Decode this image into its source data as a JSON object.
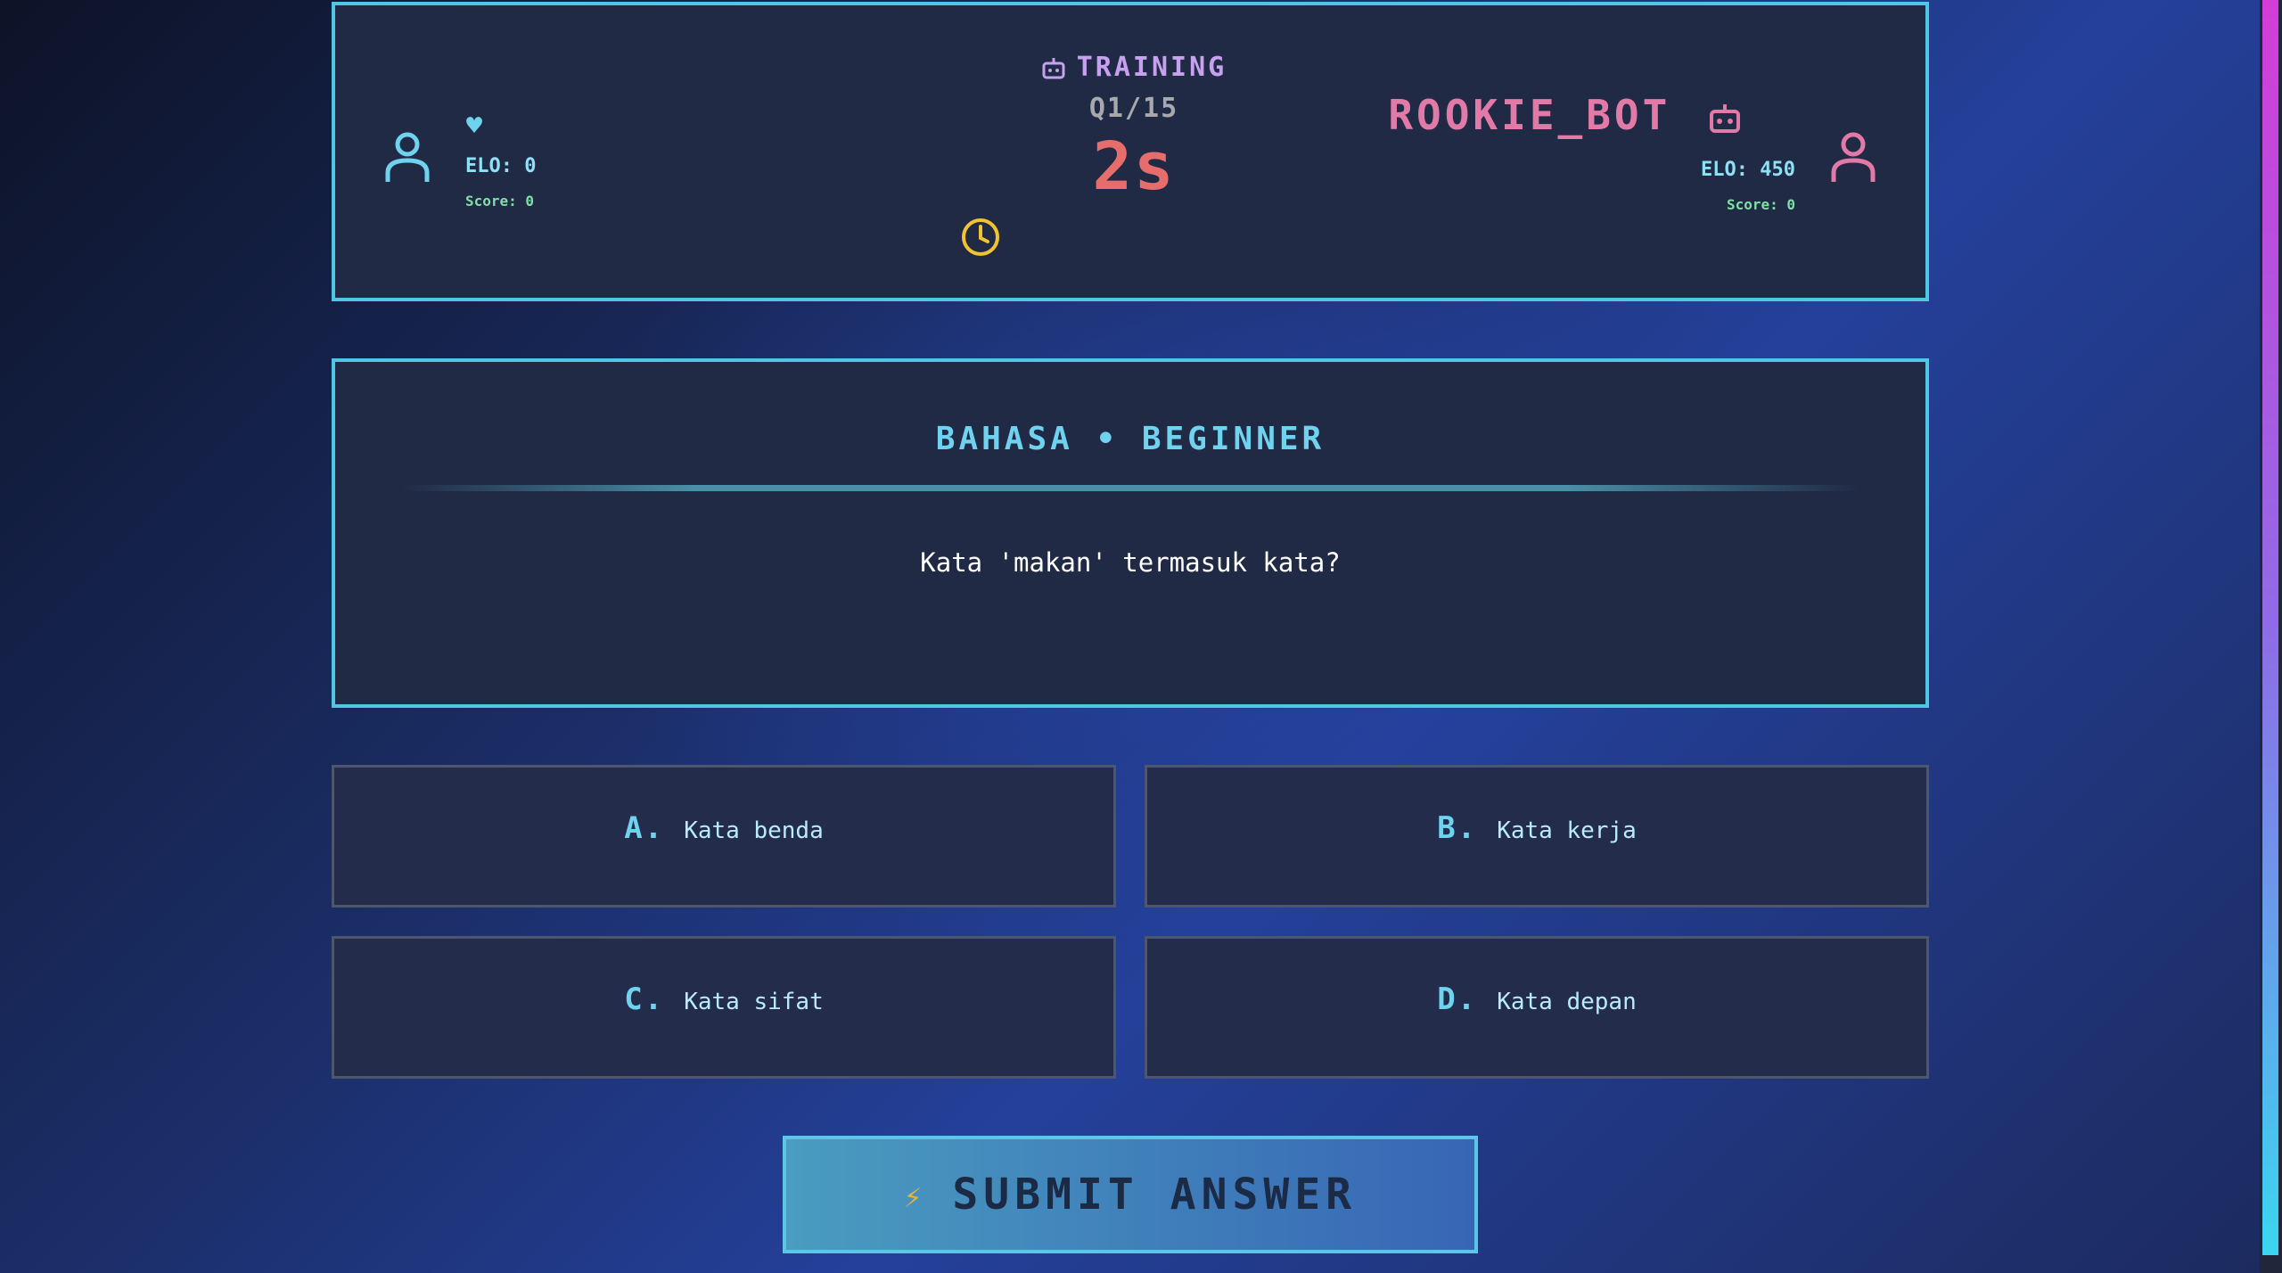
{
  "header": {
    "mode_label": "TRAINING",
    "question_counter": "Q1/15",
    "timer": "2s",
    "player": {
      "name": "",
      "elo": "ELO: 0",
      "score": "Score: 0"
    },
    "bot": {
      "name": "ROOKIE_BOT",
      "elo": "ELO: 450",
      "score": "Score: 0"
    }
  },
  "question": {
    "subject_line": "BAHASA • BEGINNER",
    "text": "Kata 'makan' termasuk kata?"
  },
  "options": [
    {
      "letter": "A.",
      "text": "Kata benda"
    },
    {
      "letter": "B.",
      "text": "Kata kerja"
    },
    {
      "letter": "C.",
      "text": "Kata sifat"
    },
    {
      "letter": "D.",
      "text": "Kata depan"
    }
  ],
  "submit": {
    "label": "SUBMIT ANSWER"
  },
  "colors": {
    "accent_cyan": "#4fc6e4",
    "bot_pink": "#e27aa8",
    "timer_red": "#e76d6d",
    "mode_purple": "#c7a0ef",
    "clock_yellow": "#f2c230",
    "score_green": "#7ee0a6"
  },
  "icons": {
    "mode": "robot-icon",
    "player_avatar": "user-icon",
    "player_badge": "heart-icon",
    "bot_badge": "robot-icon",
    "bot_avatar": "user-icon",
    "timer": "clock-icon",
    "submit": "lightning-icon"
  }
}
